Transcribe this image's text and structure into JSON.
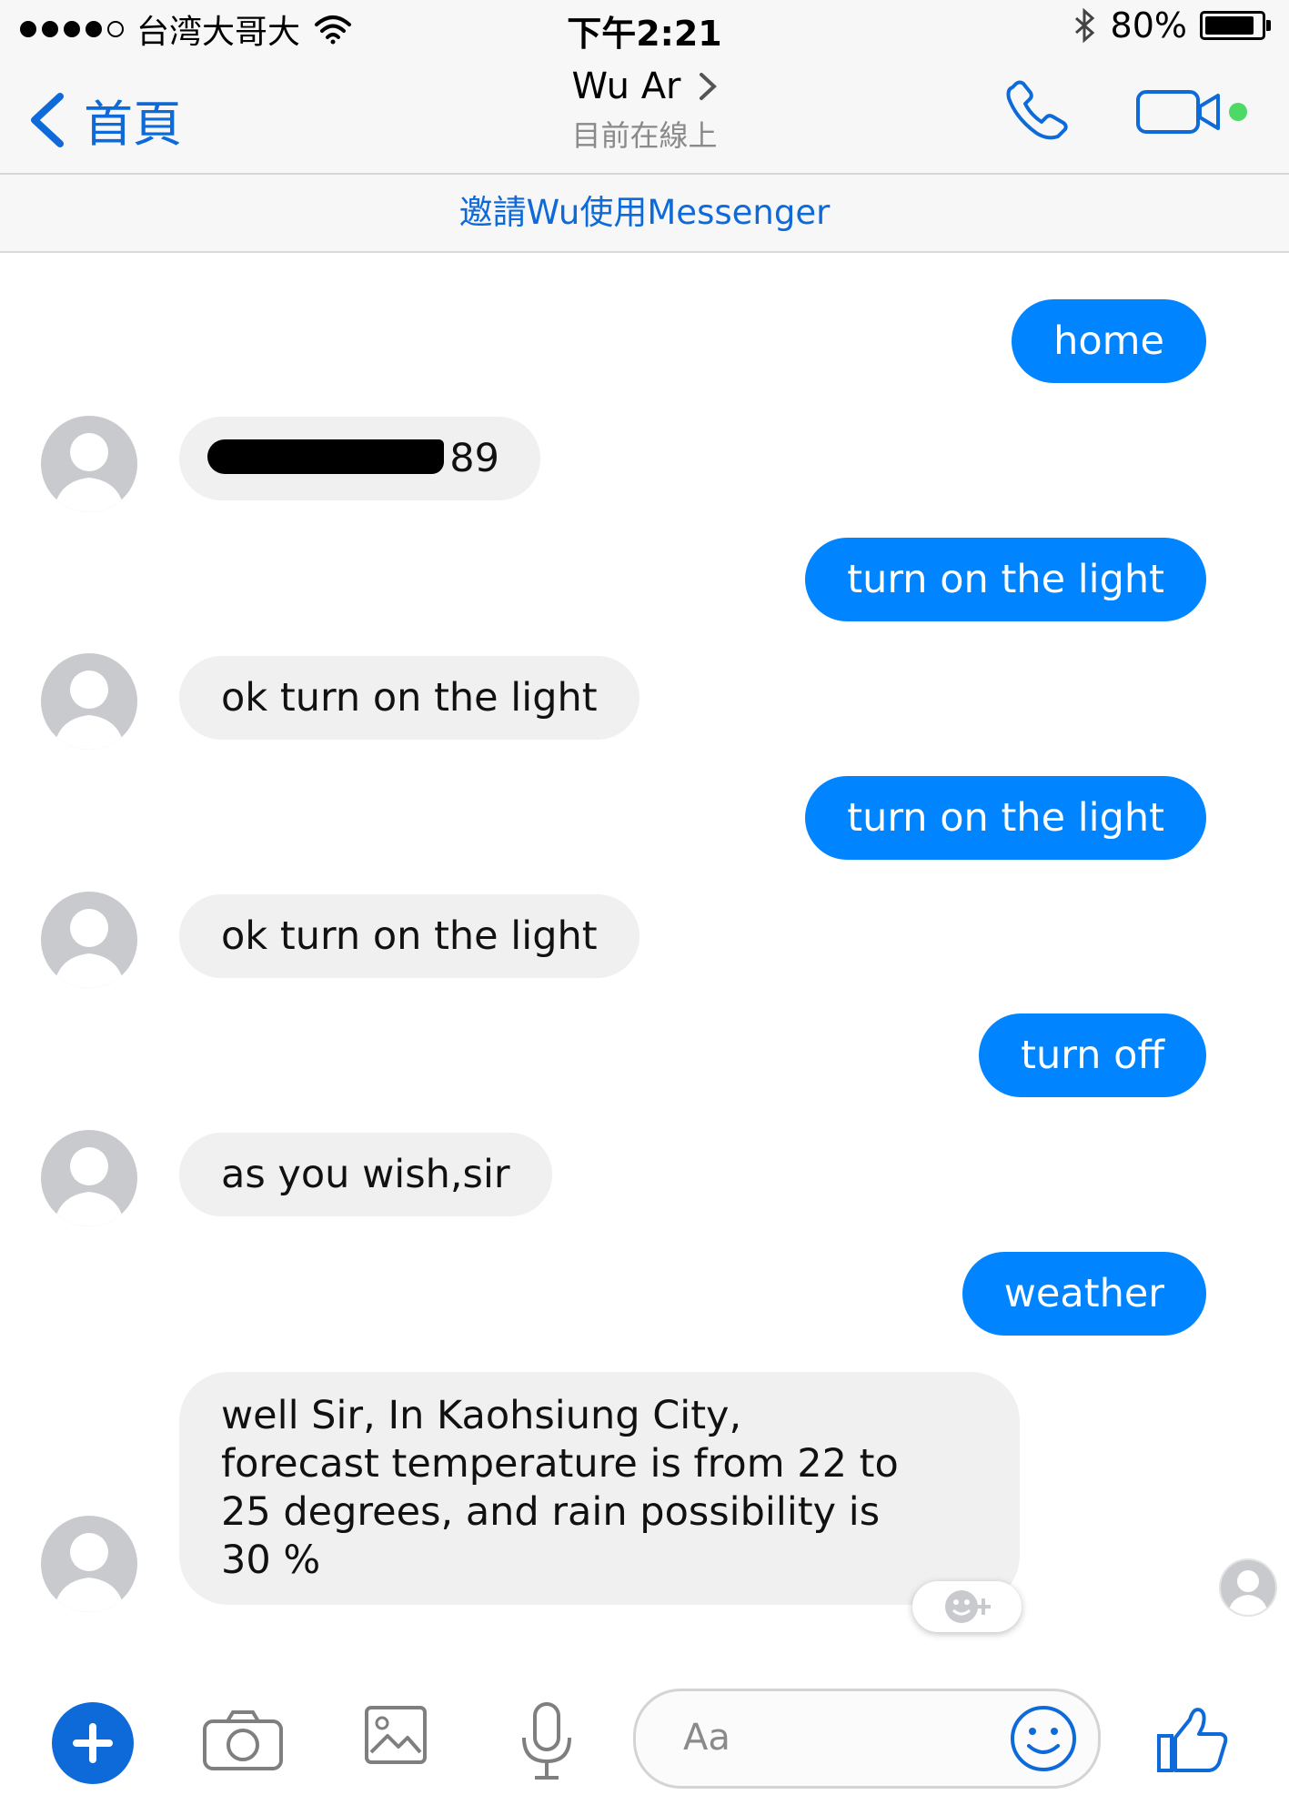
{
  "status_bar": {
    "carrier": "台湾大哥大",
    "time": "下午2:21",
    "battery": "80%",
    "battery_level": 0.8
  },
  "nav": {
    "back_label": "首頁",
    "contact_name": "Wu Ar",
    "presence": "目前在線上"
  },
  "invite_banner": "邀請Wu使用Messenger",
  "messages": [
    {
      "from": "me",
      "text": "home"
    },
    {
      "from": "them",
      "text": "89"
    },
    {
      "from": "me",
      "text": "turn on the light"
    },
    {
      "from": "them",
      "text": "ok turn on the light"
    },
    {
      "from": "me",
      "text": "turn on the light"
    },
    {
      "from": "them",
      "text": "ok turn on the light"
    },
    {
      "from": "me",
      "text": "turn off"
    },
    {
      "from": "them",
      "text": "as you wish,sir"
    },
    {
      "from": "me",
      "text": "weather"
    },
    {
      "from": "them",
      "lines": [
        "well Sir, In Kaohsiung City,",
        "forecast temperature is from 22 to",
        "25 degrees, and rain possibility is",
        "30 %"
      ]
    }
  ],
  "composer": {
    "placeholder": "Aa"
  },
  "colors": {
    "accent": "#0d6ad8",
    "outgoing_bubble": "#0084ff",
    "incoming_bubble": "#f0f0f0",
    "online_dot": "#4cd964"
  },
  "icons": [
    "signal-dots-icon",
    "wifi-icon",
    "bluetooth-icon",
    "battery-icon",
    "back-chevron-icon",
    "chevron-right-icon",
    "phone-icon",
    "video-camera-icon",
    "avatar-icon",
    "emoji-react-icon",
    "plus-icon",
    "camera-icon",
    "image-icon",
    "microphone-icon",
    "smiley-icon",
    "thumbs-up-icon"
  ]
}
